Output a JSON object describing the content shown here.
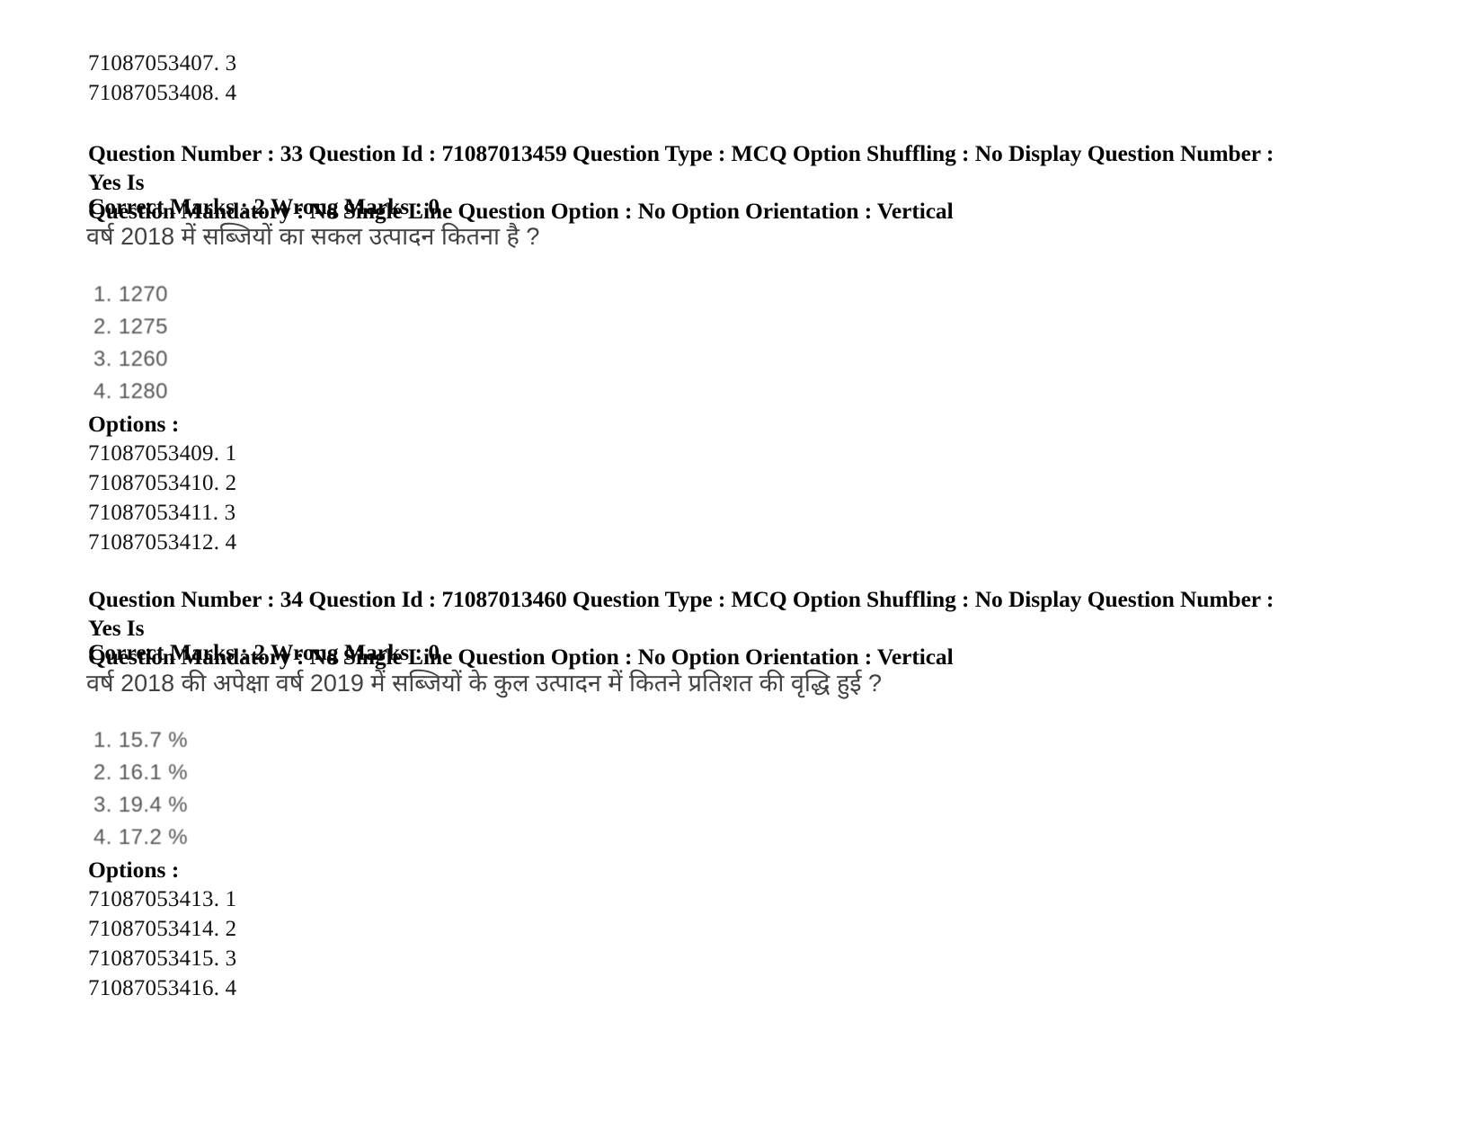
{
  "document": {
    "page_background": "#ffffff",
    "text_color": "#000000"
  },
  "previous_question_option_ids": [
    "71087053407. 3",
    "71087053408. 4"
  ],
  "questions": [
    {
      "meta_line_1": "Question Number : 33 Question Id : 71087013459 Question Type : MCQ Option Shuffling : No Display Question Number : Yes Is",
      "meta_line_2": "Question Mandatory : No Single Line Question Option : No Option Orientation : Vertical",
      "marks_line": "Correct Marks : 2 Wrong Marks : 0",
      "question_number": "33",
      "question_id": "71087013459",
      "question_type": "MCQ",
      "option_shuffling": "No",
      "display_question_number": "Yes",
      "is_question_mandatory": "No",
      "single_line_question_option": "No",
      "option_orientation": "Vertical",
      "correct_marks": "2",
      "wrong_marks": "0",
      "stem": "वर्ष 2018 में सब्जियों का सकल उत्पादन कितना है ?",
      "choices": [
        "1. 1270",
        "2. 1275",
        "3. 1260",
        "4. 1280"
      ],
      "options_label": "Options :",
      "option_ids": [
        "71087053409. 1",
        "71087053410. 2",
        "71087053411. 3",
        "71087053412. 4"
      ]
    },
    {
      "meta_line_1": "Question Number : 34 Question Id : 71087013460 Question Type : MCQ Option Shuffling : No Display Question Number : Yes Is",
      "meta_line_2": "Question Mandatory : No Single Line Question Option : No Option Orientation : Vertical",
      "marks_line": "Correct Marks : 2 Wrong Marks : 0",
      "question_number": "34",
      "question_id": "71087013460",
      "question_type": "MCQ",
      "option_shuffling": "No",
      "display_question_number": "Yes",
      "is_question_mandatory": "No",
      "single_line_question_option": "No",
      "option_orientation": "Vertical",
      "correct_marks": "2",
      "wrong_marks": "0",
      "stem": "वर्ष 2018 की अपेक्षा वर्ष 2019 में सब्जियों के कुल उत्पादन में कितने प्रतिशत की वृद्धि हुई ?",
      "choices": [
        "1. 15.7 %",
        "2. 16.1 %",
        "3. 19.4 %",
        "4. 17.2 %"
      ],
      "options_label": "Options :",
      "option_ids": [
        "71087053413. 1",
        "71087053414. 2",
        "71087053415. 3",
        "71087053416. 4"
      ]
    }
  ]
}
